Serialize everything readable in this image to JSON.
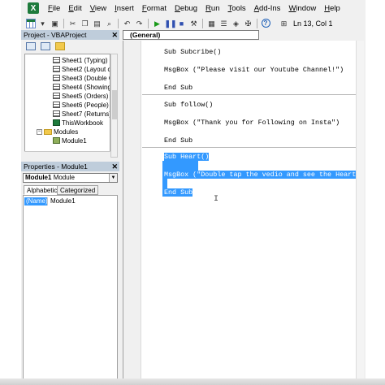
{
  "menu": [
    "File",
    "Edit",
    "View",
    "Insert",
    "Format",
    "Debug",
    "Run",
    "Tools",
    "Add-Ins",
    "Window",
    "Help"
  ],
  "status": {
    "position": "Ln 13, Col 1"
  },
  "project_pane": {
    "title": "Project - VBAProject",
    "tree": [
      {
        "label": "Sheet1 (Typing)",
        "icon": "sheet-icon"
      },
      {
        "label": "Sheet2 (Layout c",
        "icon": "sheet-icon"
      },
      {
        "label": "Sheet3 (Double C",
        "icon": "sheet-icon"
      },
      {
        "label": "Sheet4 (Showing",
        "icon": "sheet-icon"
      },
      {
        "label": "Sheet5 (Orders)",
        "icon": "sheet-icon"
      },
      {
        "label": "Sheet6 (People)",
        "icon": "sheet-icon"
      },
      {
        "label": "Sheet7 (Returns)",
        "icon": "sheet-icon"
      },
      {
        "label": "ThisWorkbook",
        "icon": "workbook-icon"
      },
      {
        "label": "Modules",
        "icon": "folder-icon"
      },
      {
        "label": "Module1",
        "icon": "module-icon"
      }
    ]
  },
  "properties_pane": {
    "title": "Properties - Module1",
    "object_name": "Module1",
    "object_type": "Module",
    "tabs": [
      "Alphabetic",
      "Categorized"
    ],
    "rows": [
      {
        "key": "(Name)",
        "value": "Module1"
      }
    ]
  },
  "code": {
    "object_combo": "(General)",
    "lines": [
      "Sub Subcribe()",
      "MsgBox (\"Please visit our Youtube Channel!\")",
      "End Sub",
      "Sub follow()",
      "MsgBox (\"Thank you for Following on Insta\")",
      "End Sub",
      "Sub Heart()",
      "MsgBox (\"Double tap the vedio and see the Heart\")",
      "End Sub"
    ]
  },
  "colors": {
    "selection": "#3399ff",
    "pane_header": "#bfcddb",
    "excel_green": "#1e7b3c"
  }
}
